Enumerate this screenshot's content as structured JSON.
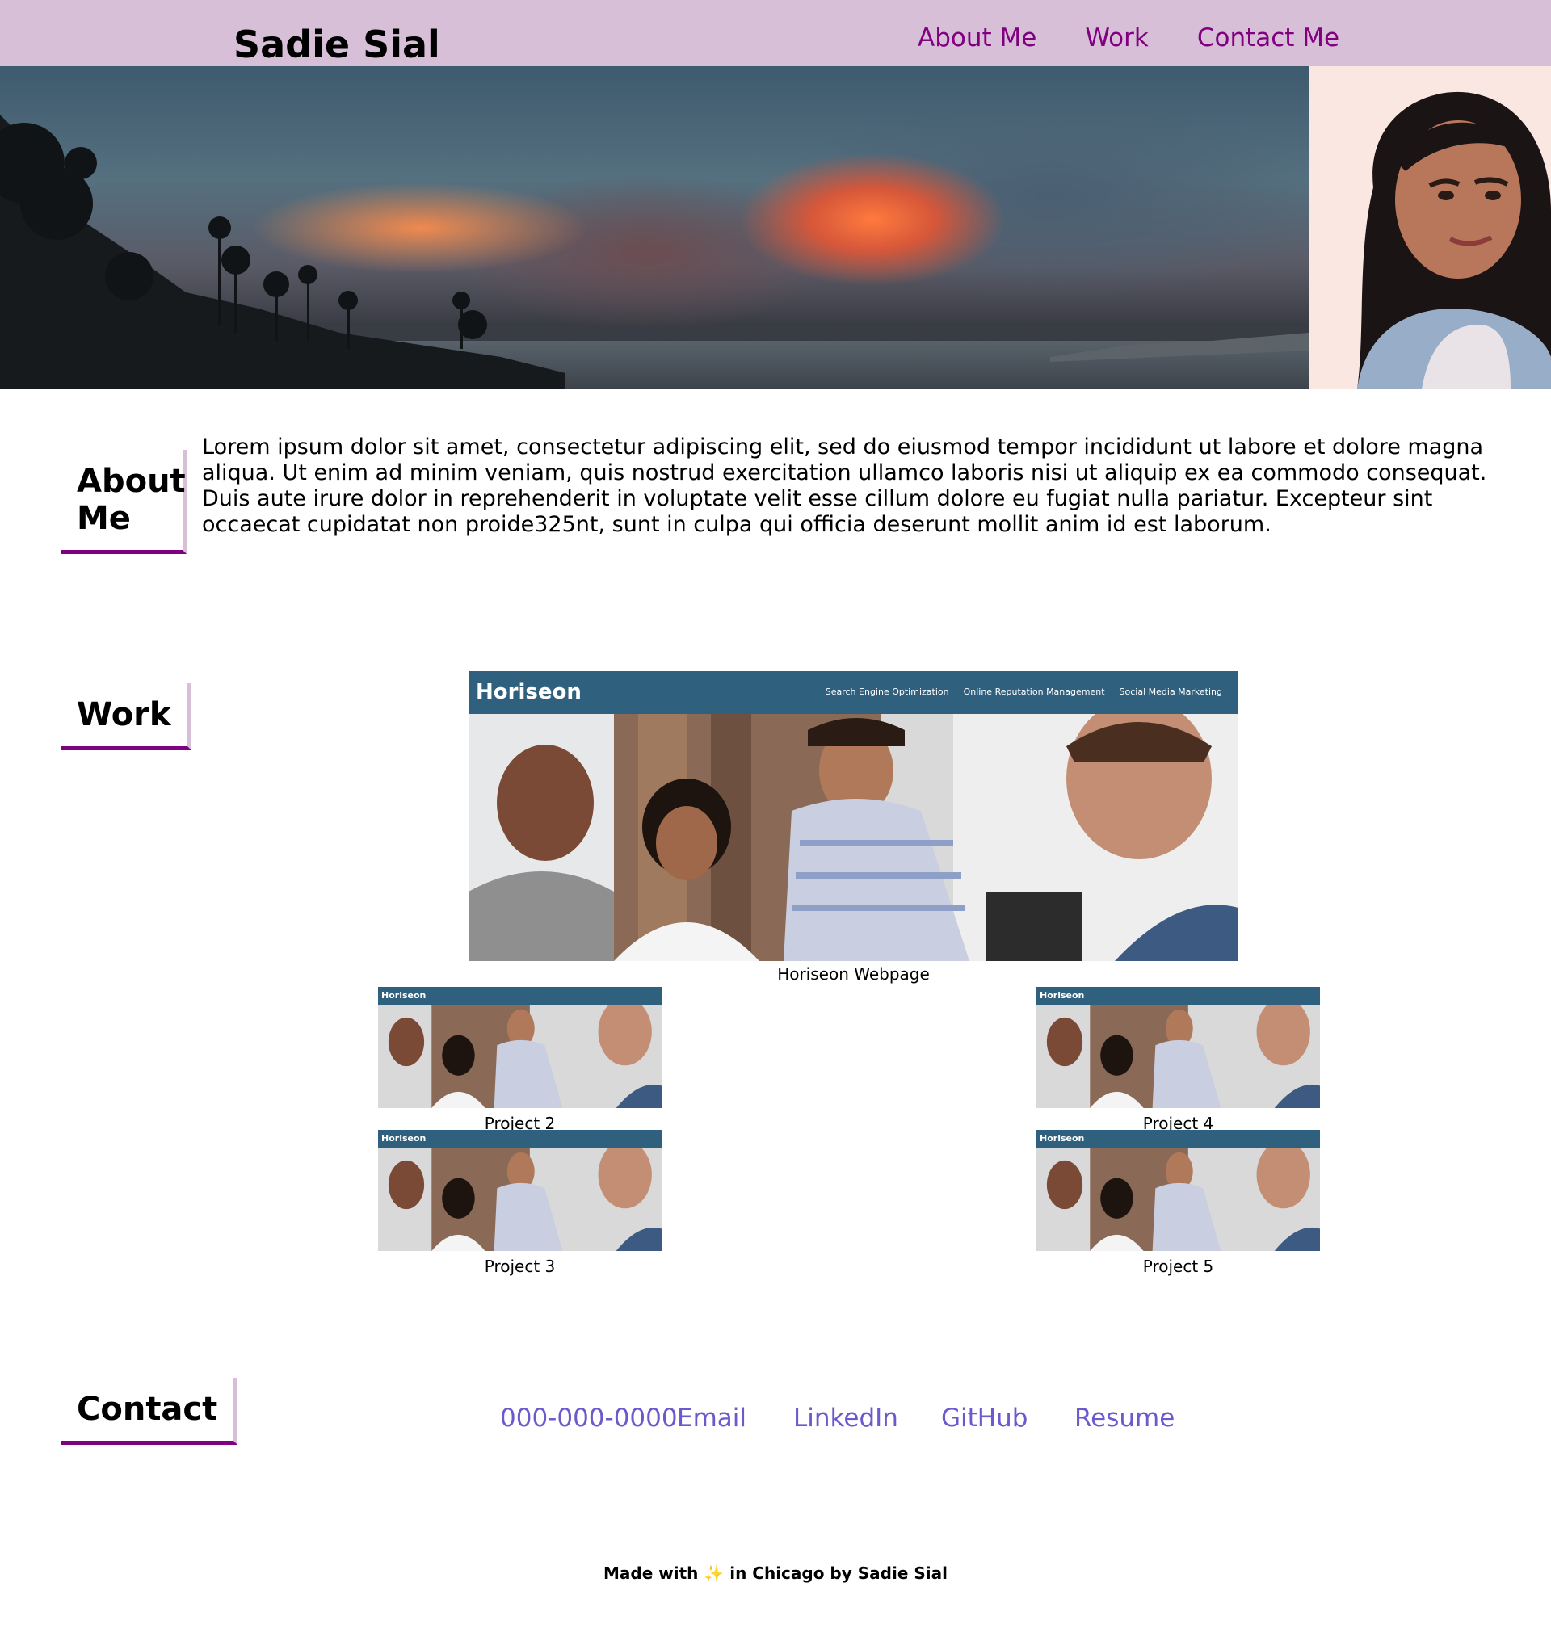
{
  "header": {
    "title": "Sadie Sial",
    "nav": [
      "About Me",
      "Work",
      "Contact Me"
    ]
  },
  "about": {
    "heading": "About Me",
    "text": "Lorem ipsum dolor sit amet, consectetur adipiscing elit, sed do eiusmod tempor incididunt ut labore et dolore magna aliqua. Ut enim ad minim veniam, quis nostrud exercitation ullamco laboris nisi ut aliquip ex ea commodo consequat. Duis aute irure dolor in reprehenderit in voluptate velit esse cillum dolore eu fugiat nulla pariatur. Excepteur sint occaecat cupidatat non proide325nt, sunt in culpa qui officia deserunt mollit anim id est laborum."
  },
  "work": {
    "heading": "Work",
    "main_caption": "Horiseon Webpage",
    "mock_brand": "Horiseon",
    "mock_nav": [
      "Search Engine Optimization",
      "Online Reputation Management",
      "Social Media Marketing"
    ],
    "projects": [
      "Project 2",
      "Project 3",
      "Project 4",
      "Project 5"
    ]
  },
  "contact": {
    "heading": "Contact",
    "links": [
      "000-000-0000",
      "Email",
      "LinkedIn",
      "GitHub",
      "Resume"
    ]
  },
  "footer": {
    "before": "Made with ",
    "icon": "✨",
    "after": " in Chicago by Sadie Sial"
  },
  "colors": {
    "header_bg": "#d8bfd8",
    "nav_link": "#800080",
    "heading_underline": "#800080",
    "contact_link": "#6a5acd",
    "mock_bar": "#2f607e"
  }
}
